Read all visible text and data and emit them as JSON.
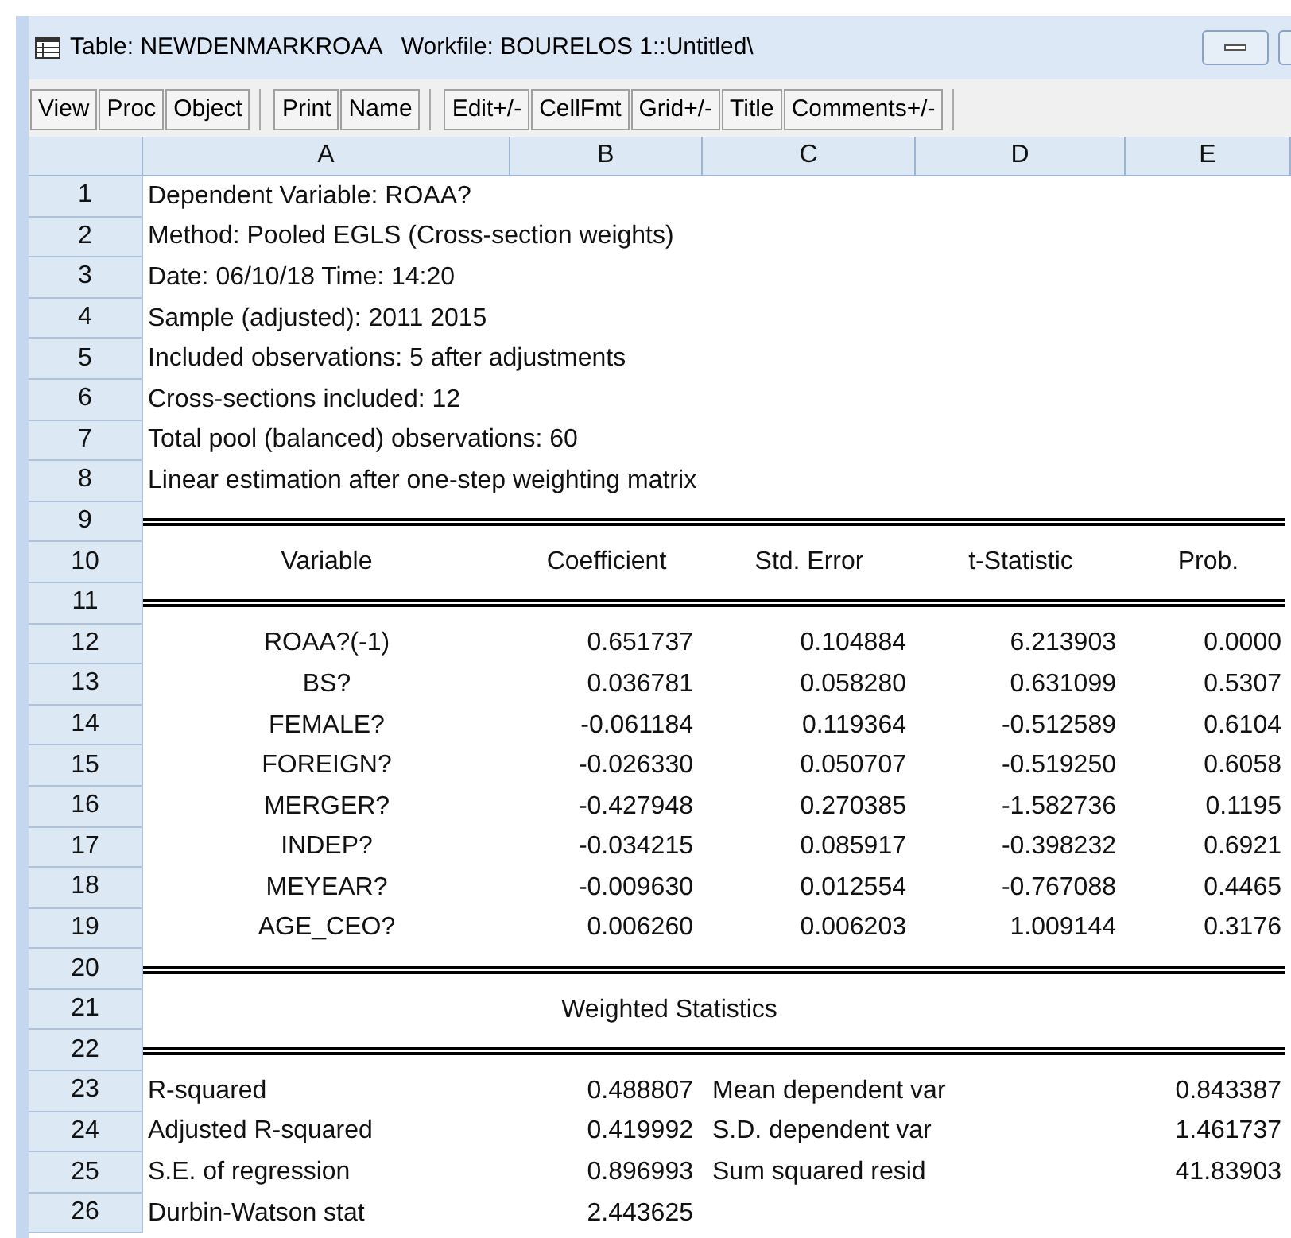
{
  "window": {
    "title": "Table: NEWDENMARKROAA   Workfile: BOURELOS 1::Untitled\\"
  },
  "toolbar": [
    [
      "View",
      "Proc",
      "Object"
    ],
    [
      "Print",
      "Name"
    ],
    [
      "Edit+/-",
      "CellFmt",
      "Grid+/-",
      "Title",
      "Comments+/-"
    ]
  ],
  "table": {
    "columns": [
      "A",
      "B",
      "C",
      "D",
      "E"
    ],
    "rows": [
      {
        "number": "1",
        "kind": "text",
        "cells": [
          "Dependent Variable: ROAA?"
        ]
      },
      {
        "number": "2",
        "kind": "text",
        "cells": [
          "Method: Pooled EGLS (Cross-section weights)"
        ]
      },
      {
        "number": "3",
        "kind": "text",
        "cells": [
          "Date: 06/10/18   Time: 14:20"
        ]
      },
      {
        "number": "4",
        "kind": "text",
        "cells": [
          "Sample (adjusted): 2011 2015"
        ]
      },
      {
        "number": "5",
        "kind": "text",
        "cells": [
          "Included observations: 5 after adjustments"
        ]
      },
      {
        "number": "6",
        "kind": "text",
        "cells": [
          "Cross-sections included: 12"
        ]
      },
      {
        "number": "7",
        "kind": "text",
        "cells": [
          "Total pool (balanced) observations: 60"
        ]
      },
      {
        "number": "8",
        "kind": "text",
        "cells": [
          "Linear estimation after one-step weighting matrix"
        ]
      },
      {
        "number": "9",
        "kind": "rule",
        "cells": []
      },
      {
        "number": "10",
        "kind": "header",
        "cells": [
          "Variable",
          "Coefficient",
          "Std. Error",
          "t-Statistic",
          "Prob."
        ]
      },
      {
        "number": "11",
        "kind": "rule",
        "cells": []
      },
      {
        "number": "12",
        "kind": "data",
        "cells": [
          "ROAA?(-1)",
          "0.651737",
          "0.104884",
          "6.213903",
          "0.0000"
        ]
      },
      {
        "number": "13",
        "kind": "data",
        "cells": [
          "BS?",
          "0.036781",
          "0.058280",
          "0.631099",
          "0.5307"
        ]
      },
      {
        "number": "14",
        "kind": "data",
        "cells": [
          "FEMALE?",
          "-0.061184",
          "0.119364",
          "-0.512589",
          "0.6104"
        ]
      },
      {
        "number": "15",
        "kind": "data",
        "cells": [
          "FOREIGN?",
          "-0.026330",
          "0.050707",
          "-0.519250",
          "0.6058"
        ]
      },
      {
        "number": "16",
        "kind": "data",
        "cells": [
          "MERGER?",
          "-0.427948",
          "0.270385",
          "-1.582736",
          "0.1195"
        ]
      },
      {
        "number": "17",
        "kind": "data",
        "cells": [
          "INDEP?",
          "-0.034215",
          "0.085917",
          "-0.398232",
          "0.6921"
        ]
      },
      {
        "number": "18",
        "kind": "data",
        "cells": [
          "MEYEAR?",
          "-0.009630",
          "0.012554",
          "-0.767088",
          "0.4465"
        ]
      },
      {
        "number": "19",
        "kind": "data",
        "cells": [
          "AGE_CEO?",
          "0.006260",
          "0.006203",
          "1.009144",
          "0.3176"
        ]
      },
      {
        "number": "20",
        "kind": "rule",
        "cells": []
      },
      {
        "number": "21",
        "kind": "title",
        "cells": [
          "Weighted Statistics"
        ]
      },
      {
        "number": "22",
        "kind": "rule",
        "cells": []
      },
      {
        "number": "23",
        "kind": "stats",
        "cells": [
          "R-squared",
          "0.488807",
          "Mean dependent var",
          "0.843387"
        ]
      },
      {
        "number": "24",
        "kind": "stats",
        "cells": [
          "Adjusted R-squared",
          "0.419992",
          "S.D. dependent var",
          "1.461737"
        ]
      },
      {
        "number": "25",
        "kind": "stats",
        "cells": [
          "S.E. of regression",
          "0.896993",
          "Sum squared resid",
          "41.83903"
        ]
      },
      {
        "number": "26",
        "kind": "stats",
        "cells": [
          "Durbin-Watson stat",
          "2.443625"
        ]
      }
    ]
  }
}
